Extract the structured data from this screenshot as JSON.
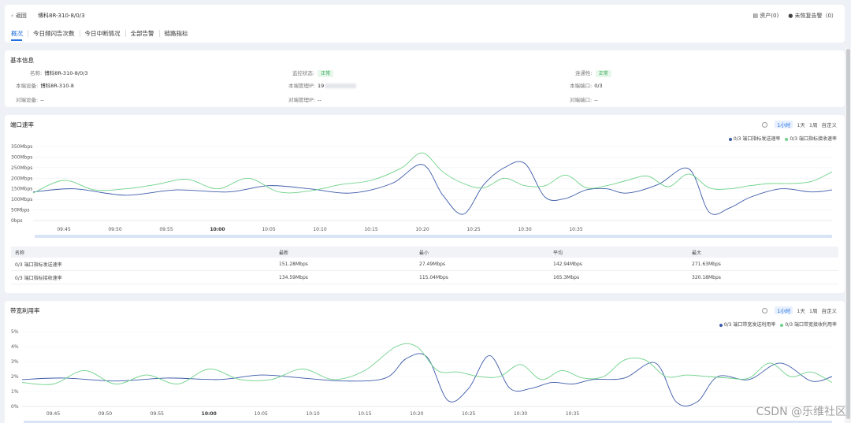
{
  "header": {
    "back_label": "返回",
    "port_title": "博科8R-310-8/0/3",
    "assets_label": "资产(0)",
    "alarms_label": "未恢复告警（0）"
  },
  "tabs": [
    {
      "label": "概况"
    },
    {
      "label": "今日频闪告次数"
    },
    {
      "label": "今日中断情况"
    },
    {
      "label": "全部告警"
    },
    {
      "label": "链路指标"
    }
  ],
  "info": {
    "title": "基本信息",
    "name_label": "名称:",
    "name_value": "博科8R-310-8/0/3",
    "monitor_label": "监控状态:",
    "monitor_value": "正常",
    "conn_label": "连通性:",
    "conn_value": "正常",
    "local_dev_label": "本端设备:",
    "local_dev_value": "博科8R-310-8",
    "local_ip_label": "本端管理IP:",
    "local_ip_value": "19",
    "local_port_label": "本端端口:",
    "local_port_value": "0/3",
    "peer_dev_label": "对端设备:",
    "peer_dev_value": "--",
    "peer_ip_label": "对端管理IP:",
    "peer_ip_value": "--",
    "peer_port_label": "对端端口:",
    "peer_port_value": "--"
  },
  "ranges": [
    "1小时",
    "1天",
    "1周",
    "自定义"
  ],
  "rate_card": {
    "title": "端口速率",
    "legend": [
      "0/3 端口指标发送速率",
      "0/3 端口指标接收速率"
    ],
    "table_headers": [
      "名称",
      "最新",
      "最小",
      "平均",
      "最大"
    ],
    "rows": [
      [
        "0/3 端口指标发送速率",
        "151.28Mbps",
        "27.49Mbps",
        "142.94Mbps",
        "271.63Mbps"
      ],
      [
        "0/3 端口指标接收速率",
        "134.59Mbps",
        "115.04Mbps",
        "165.3Mbps",
        "320.18Mbps"
      ]
    ]
  },
  "util_card": {
    "title": "带宽利用率",
    "legend": [
      "0/3 端口带宽发送利用率",
      "0/3 端口带宽接收利用率"
    ]
  },
  "watermark": "CSDN @乐维社区",
  "colors": {
    "accent": "#1f6fe0",
    "series_send": "#3d5ba9",
    "series_recv": "#6fd28a",
    "ok_badge": "#35a853"
  },
  "chart_data": [
    {
      "type": "line",
      "title": "端口速率",
      "x_ticks": [
        "09:45",
        "09:50",
        "09:55",
        "10:00",
        "10:05",
        "10:10",
        "10:15",
        "10:20",
        "10:25",
        "10:30",
        "10:35"
      ],
      "y_ticks": [
        "0bps",
        "50Mbps",
        "100Mbps",
        "150Mbps",
        "200Mbps",
        "250Mbps",
        "300Mbps",
        "350Mbps"
      ],
      "ylim": [
        0,
        350
      ],
      "x_minutes_range": [
        -18,
        60
      ],
      "series": [
        {
          "name": "0/3 端口指标发送速率",
          "x": [
            -18,
            -14,
            -9,
            -4,
            1,
            5,
            9,
            13,
            17,
            20,
            22,
            24,
            26,
            28,
            30,
            32,
            34,
            36,
            38,
            40,
            43,
            46,
            48,
            50,
            52,
            55,
            58,
            60
          ],
          "values": [
            135,
            150,
            120,
            145,
            135,
            165,
            150,
            130,
            175,
            265,
            120,
            30,
            170,
            250,
            270,
            110,
            105,
            145,
            150,
            130,
            170,
            245,
            40,
            60,
            110,
            150,
            135,
            145
          ]
        },
        {
          "name": "0/3 端口指标接收速率",
          "x": [
            -18,
            -15,
            -12,
            -9,
            -6,
            -3,
            0,
            3,
            6,
            9,
            12,
            15,
            18,
            20,
            22,
            24,
            26,
            28,
            30,
            32,
            34,
            36,
            38,
            40,
            42,
            44,
            46,
            48,
            50,
            52,
            54,
            56,
            58,
            60
          ],
          "values": [
            130,
            190,
            145,
            150,
            170,
            195,
            150,
            200,
            135,
            140,
            170,
            190,
            250,
            320,
            230,
            175,
            155,
            200,
            165,
            165,
            215,
            155,
            165,
            190,
            210,
            160,
            220,
            155,
            150,
            165,
            175,
            175,
            185,
            230
          ]
        }
      ]
    },
    {
      "type": "line",
      "title": "带宽利用率",
      "x_ticks": [
        "09:45",
        "09:50",
        "09:55",
        "10:00",
        "10:05",
        "10:10",
        "10:15",
        "10:20",
        "10:25",
        "10:30",
        "10:35"
      ],
      "y_ticks": [
        "0%",
        "1%",
        "2%",
        "3%",
        "4%",
        "5%"
      ],
      "ylim": [
        0,
        5
      ],
      "x_minutes_range": [
        -18,
        60
      ],
      "series": [
        {
          "name": "0/3 端口带宽发送利用率",
          "x": [
            -18,
            -14,
            -9,
            -4,
            1,
            5,
            9,
            13,
            17,
            19,
            21,
            23,
            25,
            27,
            29,
            31,
            33,
            35,
            37,
            40,
            43,
            45,
            47,
            49,
            52,
            55,
            58,
            60
          ],
          "values": [
            1.8,
            1.9,
            1.7,
            1.9,
            1.8,
            2.1,
            1.9,
            1.7,
            1.9,
            3.2,
            3.3,
            0.4,
            1.2,
            3.4,
            1.2,
            1.2,
            1.6,
            1.5,
            1.8,
            1.9,
            2.9,
            0.3,
            0.3,
            2.0,
            1.8,
            2.9,
            1.7,
            2.0
          ]
        },
        {
          "name": "0/3 端口带宽接收利用率",
          "x": [
            -18,
            -15,
            -12,
            -9,
            -6,
            -3,
            0,
            3,
            6,
            9,
            12,
            15,
            18,
            20,
            22,
            24,
            26,
            28,
            30,
            32,
            34,
            36,
            38,
            40,
            42,
            44,
            46,
            48,
            50,
            52,
            54,
            56,
            58,
            60
          ],
          "values": [
            1.6,
            1.5,
            2.4,
            1.5,
            2.1,
            1.5,
            2.5,
            1.8,
            1.8,
            2.5,
            1.8,
            2.4,
            4.0,
            4.0,
            2.4,
            2.3,
            2.0,
            2.0,
            2.8,
            1.8,
            2.4,
            1.9,
            2.0,
            3.1,
            3.1,
            2.0,
            2.1,
            2.0,
            1.9,
            1.9,
            2.9,
            2.0,
            2.3,
            1.6
          ]
        }
      ]
    }
  ]
}
